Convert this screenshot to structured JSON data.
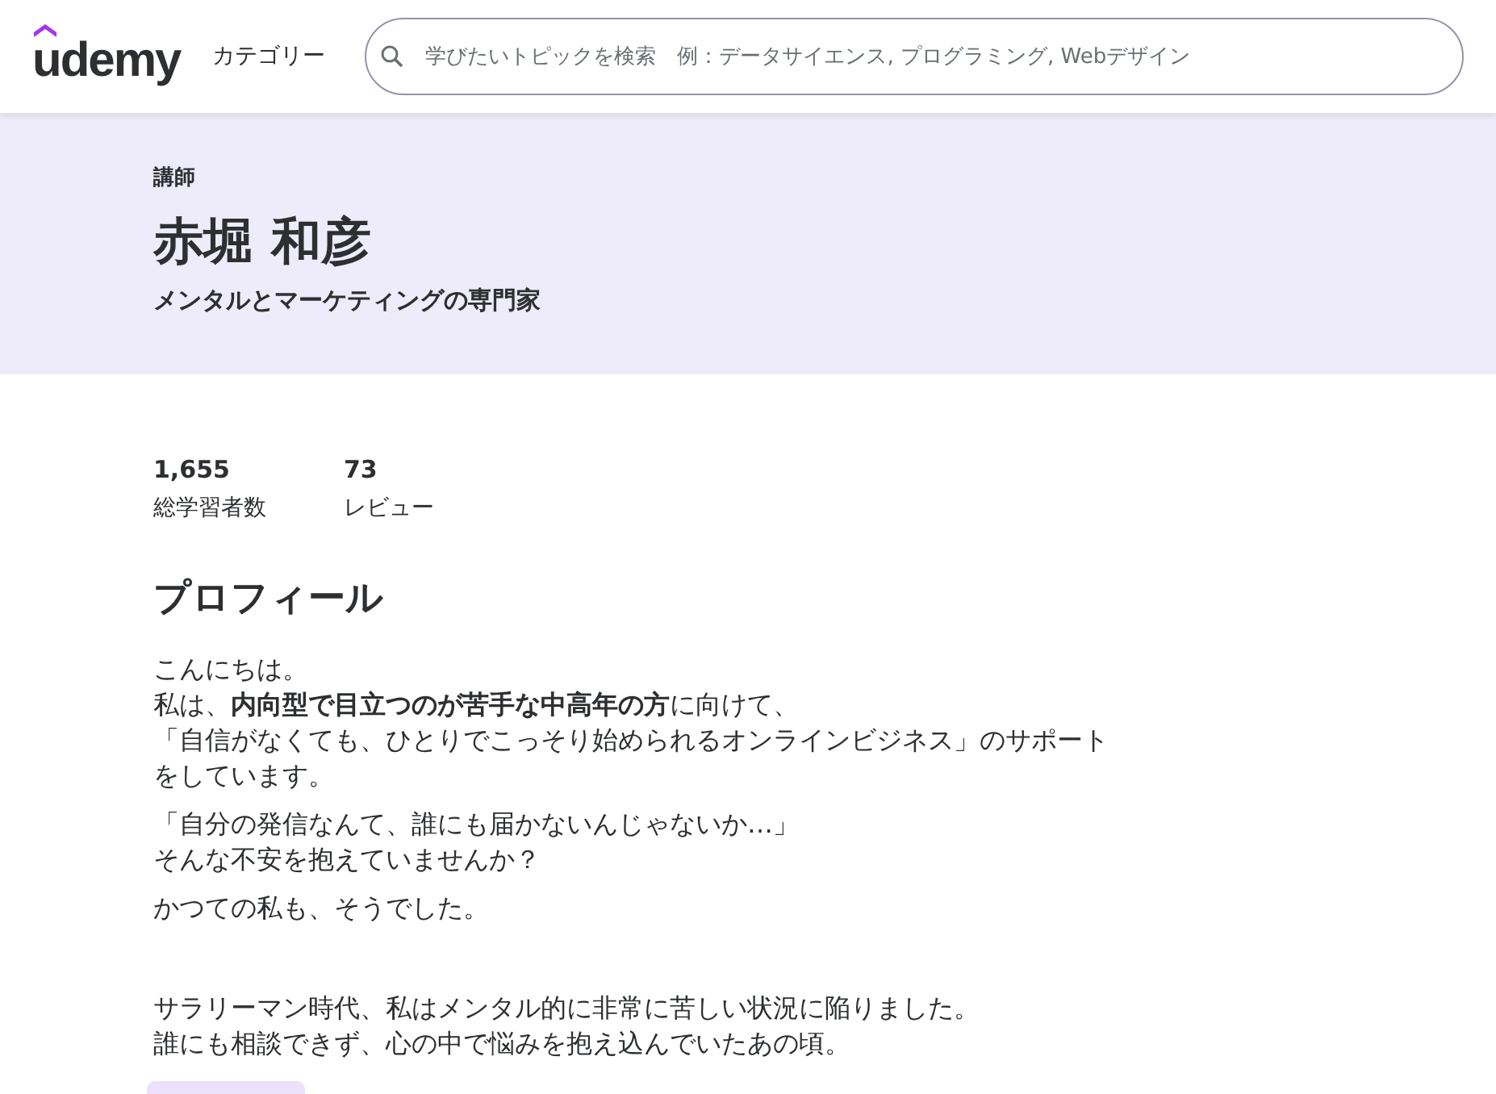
{
  "header": {
    "logo": "udemy",
    "categories": "カテゴリー",
    "search": {
      "placeholder": "学びたいトピックを検索　例：データサイエンス, プログラミング, Webデザイン"
    }
  },
  "banner": {
    "eyebrow": "講師",
    "name": "赤堀 和彦",
    "headline": "メンタルとマーケティングの専門家"
  },
  "stats": [
    {
      "value": "1,655",
      "label": "総学習者数"
    },
    {
      "value": "73",
      "label": "レビュー"
    }
  ],
  "profile": {
    "title": "プロフィール",
    "paragraphs": [
      [
        "こんにちは。",
        "私は、**内向型で目立つのが苦手な中高年の方**に向けて、",
        "「自信がなくても、ひとりでこっそり始められるオンラインビジネス」のサポートをしています。"
      ],
      [
        "「自分の発信なんて、誰にも届かないんじゃないか…」",
        "そんな不安を抱えていませんか？"
      ],
      [
        "かつての私も、そうでした。"
      ],
      [
        "サラリーマン時代、私はメンタル的に非常に苦しい状況に陥りました。",
        "誰にも相談できず、心の中で悩みを抱え込んでいたあの頃。"
      ]
    ]
  }
}
